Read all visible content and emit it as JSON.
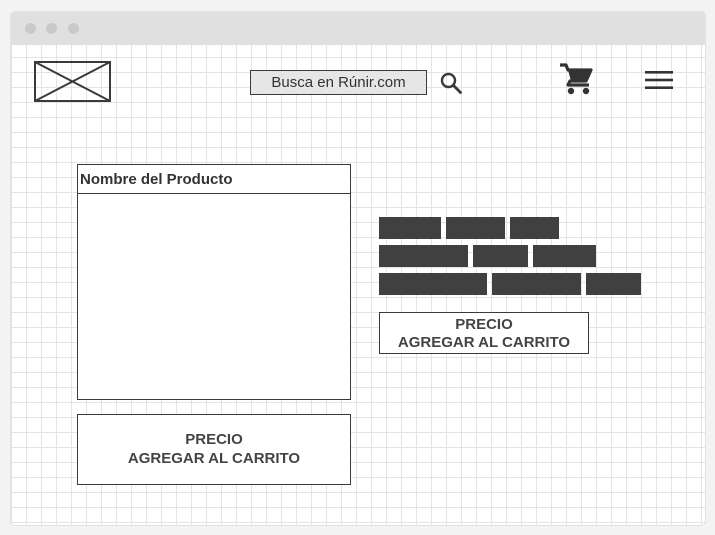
{
  "browser": {
    "controls": [
      "close-dot",
      "minimize-dot",
      "maximize-dot"
    ]
  },
  "header": {
    "logo": "image-placeholder",
    "search": {
      "value": "Busca en Rúnir.com",
      "icon": "search-icon"
    },
    "cart_icon": "cart-icon",
    "menu_icon": "hamburger-menu-icon"
  },
  "product": {
    "name": "Nombre del Producto",
    "buy_box": {
      "price_label": "PRECIO",
      "add_label": "AGREGAR AL CARRITO"
    }
  },
  "details": {
    "text_placeholder_lines": 3,
    "buy_box": {
      "price_label": "PRECIO",
      "add_label": "AGREGAR AL CARRITO"
    }
  },
  "colors": {
    "grid": "#e4e4e4",
    "ink": "#3a3a3a",
    "block": "#404040",
    "titlebar": "#e0e0e0"
  }
}
